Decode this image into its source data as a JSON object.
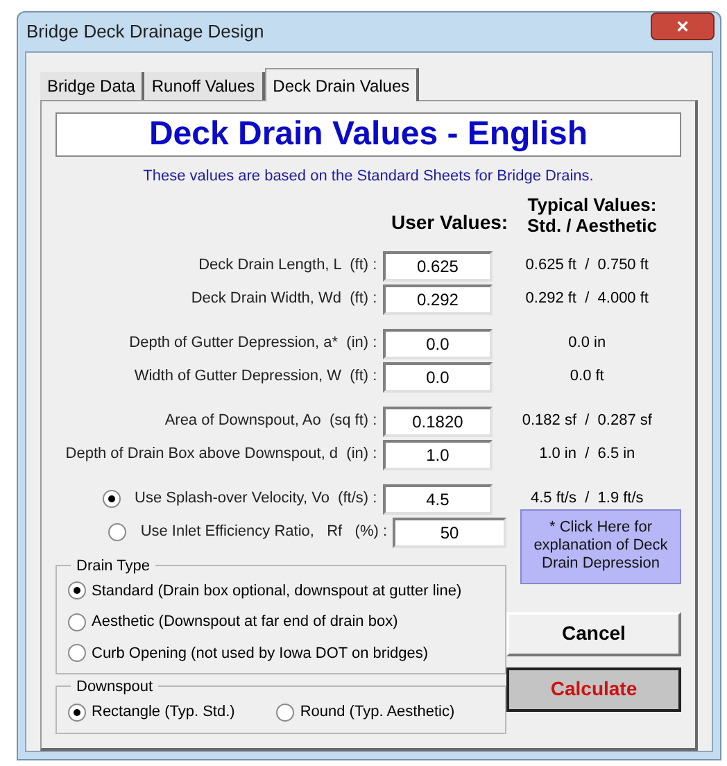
{
  "window": {
    "title": "Bridge Deck Drainage Design",
    "close": "×"
  },
  "tabs": [
    {
      "label": "Bridge Data",
      "selected": false
    },
    {
      "label": "Runoff Values",
      "selected": false
    },
    {
      "label": "Deck Drain Values",
      "selected": true
    }
  ],
  "heading": "Deck Drain Values - English",
  "subtitle": "These values are based on the Standard Sheets for Bridge Drains.",
  "user_values_header": "User Values:",
  "typical_values_header": [
    "Typical Values:",
    "Std. / Aesthetic"
  ],
  "row_groups": [
    [
      {
        "kind": "field",
        "label": "Deck Drain Length, L  (ft) :",
        "value": "0.625",
        "typical": "0.625 ft  /  0.750 ft"
      },
      {
        "kind": "field",
        "label": "Deck Drain Width, Wd  (ft) :",
        "value": "0.292",
        "typical": "0.292 ft  /  4.000 ft"
      }
    ],
    [
      {
        "kind": "field",
        "label": "Depth of Gutter Depression, a*  (in) :",
        "value": "0.0",
        "typical": "0.0 in"
      },
      {
        "kind": "field",
        "label": "Width of Gutter Depression, W  (ft) :",
        "value": "0.0",
        "typical": "0.0 ft"
      }
    ],
    [
      {
        "kind": "field",
        "label": "Area of Downspout, Ao  (sq ft) :",
        "value": "0.1820",
        "typical": "0.182 sf  /  0.287 sf"
      },
      {
        "kind": "field",
        "label": "Depth of Drain Box above Downspout, d  (in) :",
        "value": "1.0",
        "typical": "1.0 in  /  6.5 in"
      }
    ],
    [
      {
        "kind": "radio",
        "selected": true,
        "label": "Use Splash-over Velocity, Vo  (ft/s) :",
        "value": "4.5",
        "typical": "4.5 ft/s  /  1.9 ft/s"
      },
      {
        "kind": "radio",
        "selected": false,
        "label": "Use Inlet Efficiency Ratio,   Rf   (%) :",
        "value": "50"
      }
    ]
  ],
  "drain_type": {
    "title": "Drain Type",
    "options": [
      {
        "label": "Standard (Drain box optional, downspout at gutter line)",
        "selected": true
      },
      {
        "label": "Aesthetic (Downspout at far end of drain box)",
        "selected": false
      },
      {
        "label": "Curb Opening (not used by Iowa DOT on bridges)",
        "selected": false
      }
    ]
  },
  "downspout": {
    "title": "Downspout",
    "options": [
      {
        "label": "Rectangle (Typ. Std.)",
        "selected": true
      },
      {
        "label": "Round (Typ. Aesthetic)",
        "selected": false
      }
    ]
  },
  "explanation_button": "* Click Here for explanation of Deck Drain Depression",
  "cancel_button": "Cancel",
  "calculate_button": "Calculate"
}
